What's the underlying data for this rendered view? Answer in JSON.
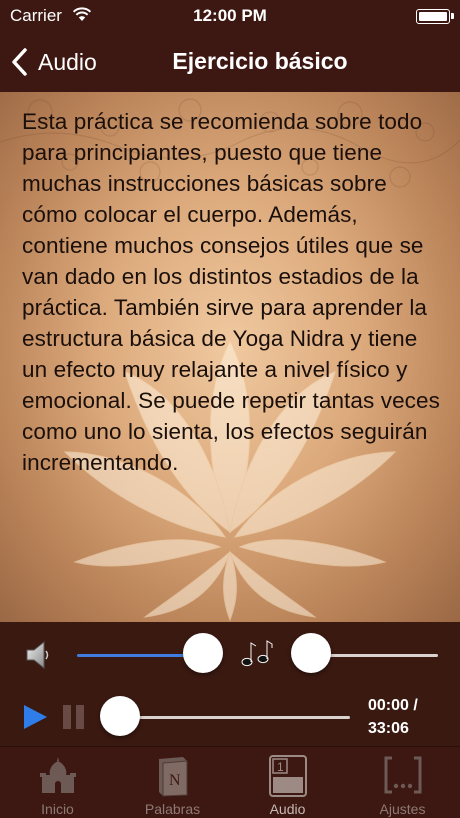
{
  "status_bar": {
    "carrier": "Carrier",
    "time": "12:00 PM"
  },
  "nav": {
    "back_label": "Audio",
    "title": "Ejercicio básico"
  },
  "content": {
    "description": "Esta práctica se recomienda sobre todo para principiantes, puesto que tiene muchas instrucciones básicas sobre cómo colocar el cuerpo. Además, contiene muchos consejos útiles que se van dado en los distintos estadios de la práctica. También sirve para aprender la estructura básica de Yoga Nidra y tiene un efecto muy relajante a nivel físico y emocional. Se puede repetir tantas veces como uno lo sienta, los efectos seguirán incrementando."
  },
  "player": {
    "volume_level": 0.98,
    "music_mix_level": 0.0,
    "progress": 0.0,
    "time_current": "00:00 /",
    "time_total": "33:06",
    "accent_color": "#3f7de0"
  },
  "tabs": [
    {
      "label": "Inicio",
      "icon": "temple-icon",
      "active": false
    },
    {
      "label": "Palabras",
      "icon": "book-icon",
      "active": false
    },
    {
      "label": "Audio",
      "icon": "audio-list-icon",
      "active": true
    },
    {
      "label": "Ajustes",
      "icon": "settings-brackets-icon",
      "active": false
    }
  ],
  "colors": {
    "bar_background": "#3d1712",
    "tab_inactive": "#8e7a74",
    "tab_active": "#c7b9b3"
  }
}
